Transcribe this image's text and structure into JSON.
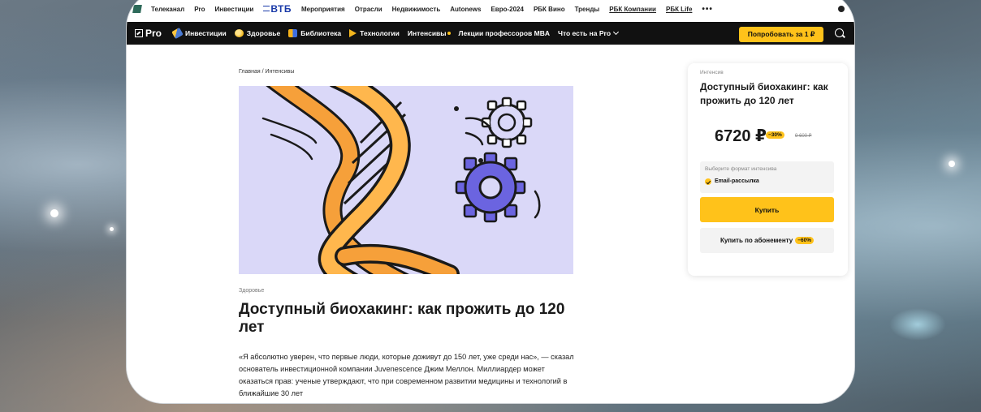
{
  "topnav": {
    "items": [
      "Телеканал",
      "Pro",
      "Инвестиции",
      "Мероприятия",
      "Отрасли",
      "Недвижимость",
      "Autonews",
      "Евро-2024",
      "РБК Вино",
      "Тренды",
      "РБК Компании",
      "РБК Life"
    ],
    "sponsor": "ВТБ",
    "more": "•••"
  },
  "nav": {
    "logo": "Pro",
    "items": [
      "Инвестиции",
      "Здоровье",
      "Библиотека",
      "Технологии",
      "Интенсивы",
      "Лекции профессоров MBA",
      "Что есть на Pro"
    ],
    "try_button": "Попробовать за 1 ₽"
  },
  "article": {
    "breadcrumb": "Главная / Интенсивы",
    "category": "Здоровье",
    "title": "Доступный биохакинг: как прожить до 120 лет",
    "lead": "«Я абсолютно уверен, что первые люди, которые доживут до 150 лет, уже среди нас», — сказал основатель инвестиционной компании Juvenescence Джим Меллон. Миллиардер может оказаться прав: ученые утверждают, что при современном развитии медицины и технологий в ближайшие 30 лет"
  },
  "card": {
    "kicker": "Интенсив",
    "title": "Доступный биохакинг: как прожить до 120 лет",
    "price": "6720 ₽",
    "discount": "−30%",
    "old_price": "9 600 ₽",
    "format_label": "Выберите формат интенсива",
    "format_value": "Email-рассылка",
    "buy_button": "Купить",
    "subscription_button": "Купить по абонементу",
    "subscription_discount": "−60%"
  },
  "colors": {
    "accent": "#ffc21a",
    "navbar": "#111111",
    "hero_bg": "#dad8f8",
    "dna_orange": "#f6a03a",
    "gear_blue": "#6b64e0"
  }
}
